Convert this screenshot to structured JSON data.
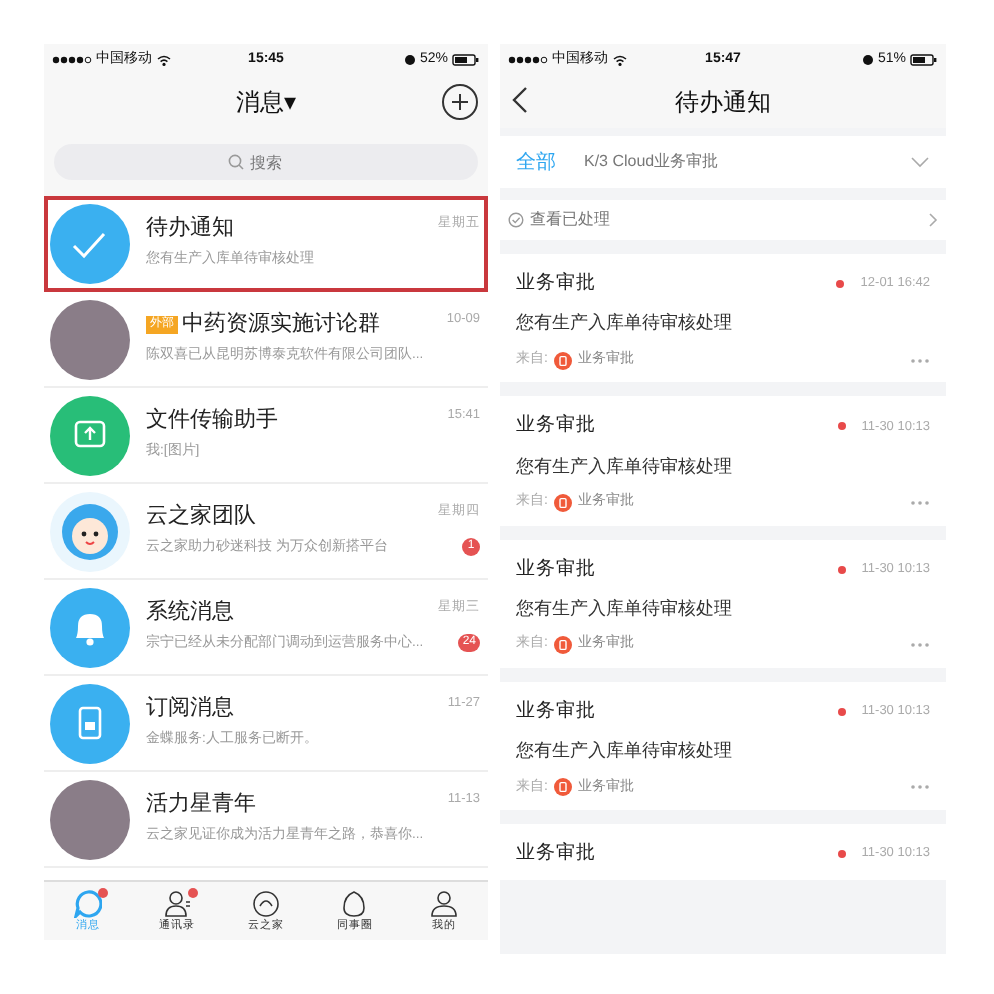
{
  "left_screen": {
    "status_bar": {
      "carrier": "中国移动",
      "time": "15:45",
      "battery": "52%"
    },
    "header": {
      "title": "消息▾"
    },
    "search": {
      "placeholder": "搜索"
    },
    "conversations": [
      {
        "kind": "check",
        "title": "待办通知",
        "preview": "您有生产入库单待审核处理",
        "time": "星期五",
        "highlighted": true
      },
      {
        "kind": "photo",
        "tag": "外部",
        "title": "中药资源实施讨论群",
        "preview": "陈双喜已从昆明苏博泰克软件有限公司团队...",
        "time": "10-09",
        "highlighted": false
      },
      {
        "kind": "upload",
        "title": "文件传输助手",
        "preview": "我:[图片]",
        "time": "15:41",
        "highlighted": false
      },
      {
        "kind": "mascot",
        "title": "云之家团队",
        "preview": "云之家助力砂迷科技 为万众创新搭平台",
        "time": "星期四",
        "badge": "1",
        "highlighted": false
      },
      {
        "kind": "bell",
        "title": "系统消息",
        "preview": "宗宁已经从未分配部门调动到运营服务中心...",
        "time": "星期三",
        "badge": "24",
        "highlighted": false
      },
      {
        "kind": "doc",
        "title": "订阅消息",
        "preview": "金蝶服务:人工服务已断开。",
        "time": "11-27",
        "highlighted": false
      },
      {
        "kind": "photo",
        "title": "活力星青年",
        "preview": "云之家见证你成为活力星青年之路，恭喜你...",
        "time": "11-13",
        "highlighted": false
      }
    ],
    "tab_bar": [
      {
        "label": "消息",
        "selected": true,
        "dot": true
      },
      {
        "label": "通讯录",
        "selected": false,
        "dot": true
      },
      {
        "label": "云之家",
        "selected": false,
        "dot": false
      },
      {
        "label": "同事圈",
        "selected": false,
        "dot": false
      },
      {
        "label": "我的",
        "selected": false,
        "dot": false
      }
    ]
  },
  "right_screen": {
    "status_bar": {
      "carrier": "中国移动",
      "time": "15:47",
      "battery": "51%"
    },
    "header": {
      "title": "待办通知"
    },
    "filters": [
      {
        "label": "全部",
        "selected": true
      },
      {
        "label": "K/3 Cloud业务审批",
        "selected": false
      }
    ],
    "processed_link": "查看已处理",
    "tasks": [
      {
        "title": "业务审批",
        "time": "12-01 16:42",
        "message": "您有生产入库单待审核处理",
        "from_label": "来自:",
        "source": "业务审批",
        "unread": true
      },
      {
        "title": "业务审批",
        "time": "11-30 10:13",
        "message": "您有生产入库单待审核处理",
        "from_label": "来自:",
        "source": "业务审批",
        "unread": true
      },
      {
        "title": "业务审批",
        "time": "11-30 10:13",
        "message": "您有生产入库单待审核处理",
        "from_label": "来自:",
        "source": "业务审批",
        "unread": true
      },
      {
        "title": "业务审批",
        "time": "11-30 10:13",
        "message": "您有生产入库单待审核处理",
        "from_label": "来自:",
        "source": "业务审批",
        "unread": true
      },
      {
        "title": "业务审批",
        "time": "11-30 10:13",
        "unread": true
      }
    ]
  }
}
